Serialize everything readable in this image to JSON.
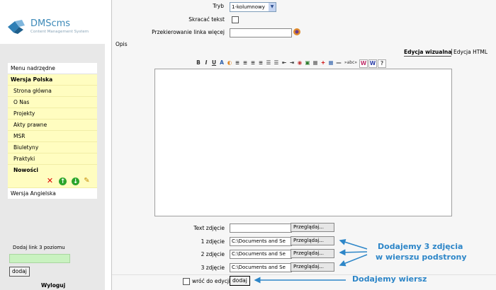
{
  "logo": {
    "name": "DMScms",
    "tagline": "Content Management System"
  },
  "sidebar": {
    "menu_header": "Menu nadrzędne",
    "section_pl": "Wersja Polska",
    "items": [
      "Strona główna",
      "O Nas",
      "Projekty",
      "Akty prawne",
      "MSR",
      "Biuletyny",
      "Praktyki"
    ],
    "current_item": "Nowości",
    "section_en": "Wersja Angielska",
    "add_label": "Dodaj link 3 poziomu",
    "add_button": "dodaj",
    "logout": "Wyloguj",
    "colors": {
      "menu_bg": "#fffdc0",
      "input_green": "#c9f2c0"
    }
  },
  "form": {
    "mode_label": "Tryb",
    "mode_value": "1-kolumnowy",
    "shorten_label": "Skracać tekst",
    "redirect_label": "Przekierowanie linka więcej",
    "desc_label": "Opis",
    "tab_visual": "Edycja wizualna",
    "tab_html": "Edycja HTML",
    "text_photo_label": "Text zdjęcie",
    "browse_label": "Przeglądaj...",
    "photos": [
      {
        "label": "1 zdjęcie",
        "value": "C:\\Documents and Se"
      },
      {
        "label": "2 zdjęcie",
        "value": "C:\\Documents and Se"
      },
      {
        "label": "3 zdjęcie",
        "value": "C:\\Documents and Se"
      }
    ],
    "return_label": "wróć do edycji",
    "add_button": "dodaj"
  },
  "toolbar": [
    "B",
    "I",
    "U",
    "A",
    "◐",
    "≡",
    "≡",
    "≡",
    "≡",
    "☰",
    "☰",
    "⇤",
    "⇥",
    "◉",
    "▣",
    "▦",
    "+",
    "▦",
    "—",
    "»abc»",
    "W",
    "W",
    "?"
  ],
  "annotations": {
    "photos_note_line1": "Dodajemy 3 zdjęcia",
    "photos_note_line2": "w wierszu podstrony",
    "row_note": "Dodajemy wiersz",
    "color": "#2d86c8"
  }
}
